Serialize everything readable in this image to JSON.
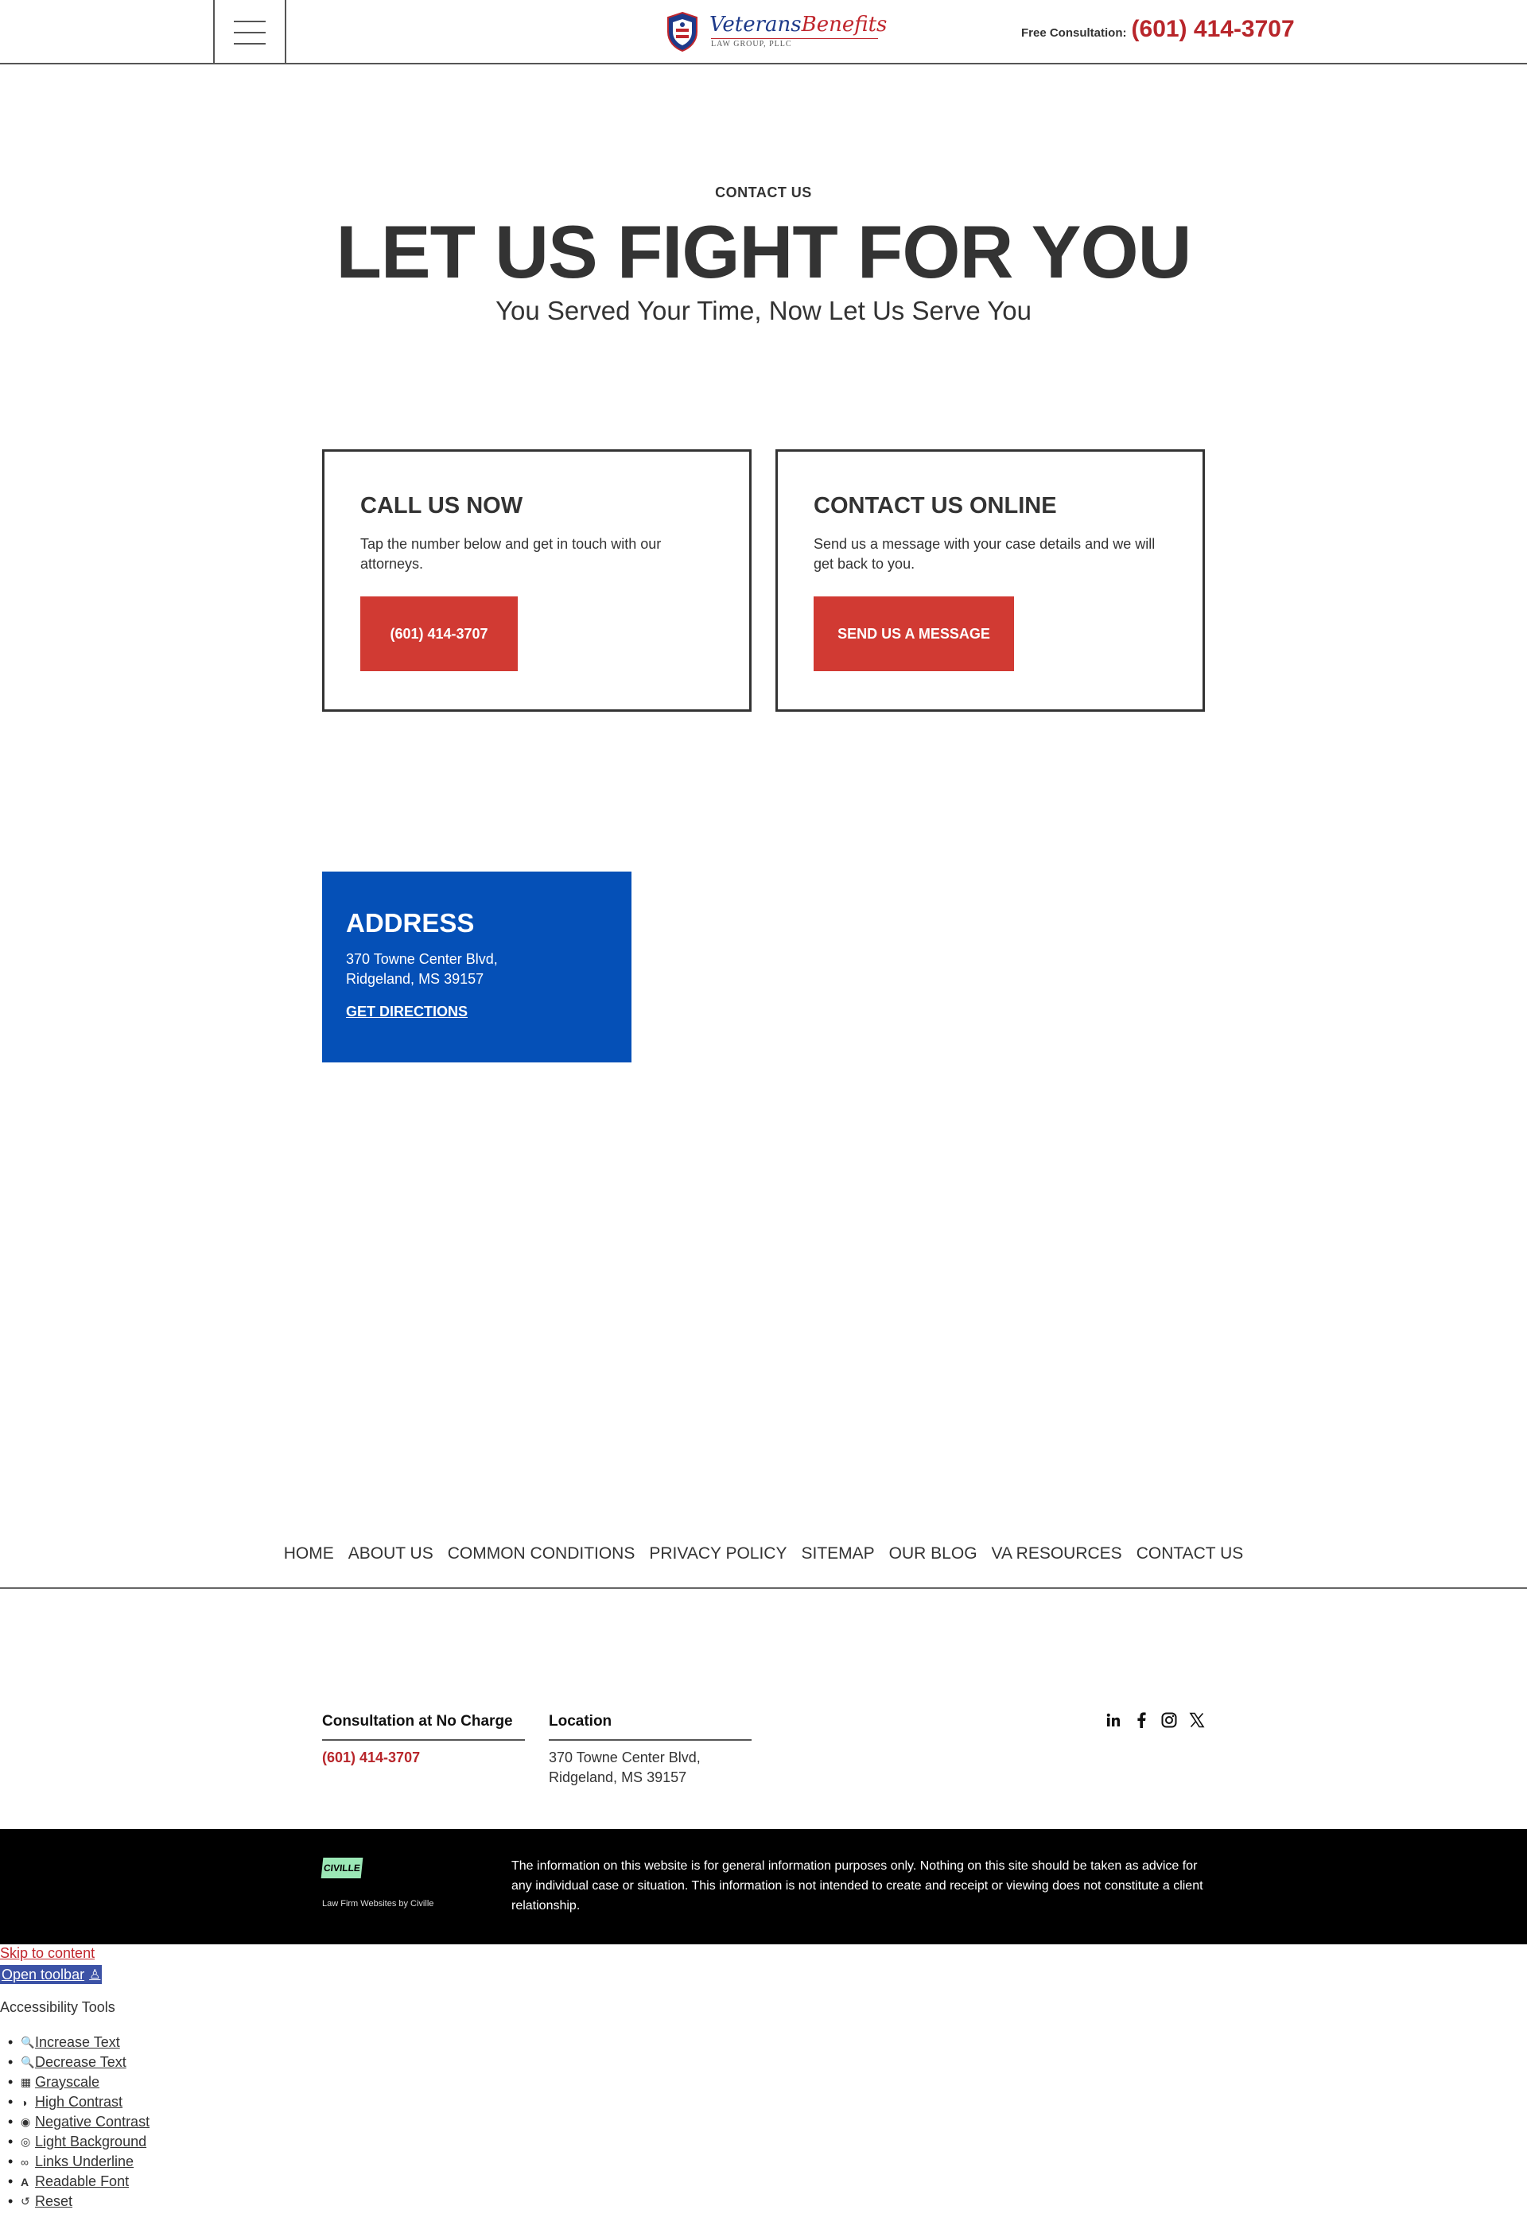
{
  "header": {
    "logo_main": "Veterans",
    "logo_script": "Benefits",
    "logo_sub": "LAW GROUP, PLLC",
    "consult_label": "Free Consultation:",
    "consult_phone": "(601) 414-3707"
  },
  "hero": {
    "eyebrow": "CONTACT US",
    "title": "LET US FIGHT FOR YOU",
    "subtitle": "You Served Your Time, Now Let Us Serve You"
  },
  "cards": [
    {
      "title": "CALL US NOW",
      "description": "Tap the number below and get in touch with our attorneys.",
      "button": "(601) 414-3707"
    },
    {
      "title": "CONTACT US ONLINE",
      "description": "Send us a message with your case details and we will get back to you.",
      "button": "SEND US A MESSAGE"
    }
  ],
  "address": {
    "title": "ADDRESS",
    "line1": "370 Towne Center Blvd,",
    "line2": "Ridgeland, MS 39157",
    "link": "GET DIRECTIONS"
  },
  "footer_nav": [
    "HOME",
    "ABOUT US",
    "COMMON CONDITIONS",
    "PRIVACY POLICY",
    "SITEMAP",
    "OUR BLOG",
    "VA RESOURCES",
    "CONTACT US"
  ],
  "footer": {
    "consult_title": "Consultation at No Charge",
    "consult_phone": "(601) 414-3707",
    "location_title": "Location",
    "location_line1": "370 Towne Center Blvd,",
    "location_line2": "Ridgeland, MS 39157",
    "social": [
      "linkedin-icon",
      "facebook-icon",
      "instagram-icon",
      "x-icon"
    ]
  },
  "bottom_bar": {
    "logo": "CIVILLE",
    "caption": "Law Firm Websites by Civille",
    "disclaimer": "The information on this website is for general information purposes only. Nothing on this site should be taken as advice for any individual case or situation. This information is not intended to create and receipt or viewing does not constitute a client relationship."
  },
  "accessibility": {
    "skip": "Skip to content",
    "open_toolbar": "Open toolbar",
    "title": "Accessibility Tools",
    "items": [
      "Increase Text",
      "Decrease Text",
      "Grayscale",
      "High Contrast",
      "Negative Contrast",
      "Light Background",
      "Links Underline",
      "Readable Font",
      "Reset"
    ]
  },
  "colors": {
    "accent_red": "#d13a33",
    "phone_red": "#b8262b",
    "address_blue": "#0550b7"
  }
}
